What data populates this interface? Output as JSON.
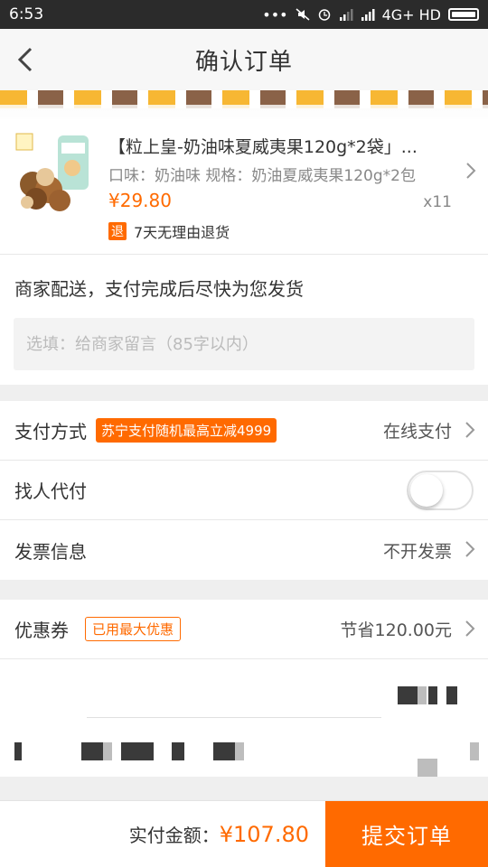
{
  "status_bar": {
    "time": "6:53",
    "network": "4G+ HD"
  },
  "nav": {
    "title": "确认订单"
  },
  "product": {
    "title": "【粒上皇-奶油味夏威夷果120g*2袋」...",
    "spec": "口味：奶油味  规格：奶油夏威夷果120g*2包",
    "price": "¥29.80",
    "quantity": "x11",
    "return_badge": "退",
    "return_text": "7天无理由退货"
  },
  "shipping": {
    "text": "商家配送，支付完成后尽快为您发货"
  },
  "memo": {
    "placeholder": "选填：给商家留言（85字以内）"
  },
  "payment": {
    "label": "支付方式",
    "promo": "苏宁支付随机最高立减4999",
    "value": "在线支付"
  },
  "proxy_pay": {
    "label": "找人代付"
  },
  "invoice": {
    "label": "发票信息",
    "value": "不开发票"
  },
  "coupon": {
    "label": "优惠券",
    "tag": "已用最大优惠",
    "value": "节省120.00元"
  },
  "footer": {
    "total_label": "实付金额：",
    "total_amount": "¥107.80",
    "submit_label": "提交订单"
  },
  "colors": {
    "accent": "#ff6a00",
    "background": "#efefef"
  }
}
